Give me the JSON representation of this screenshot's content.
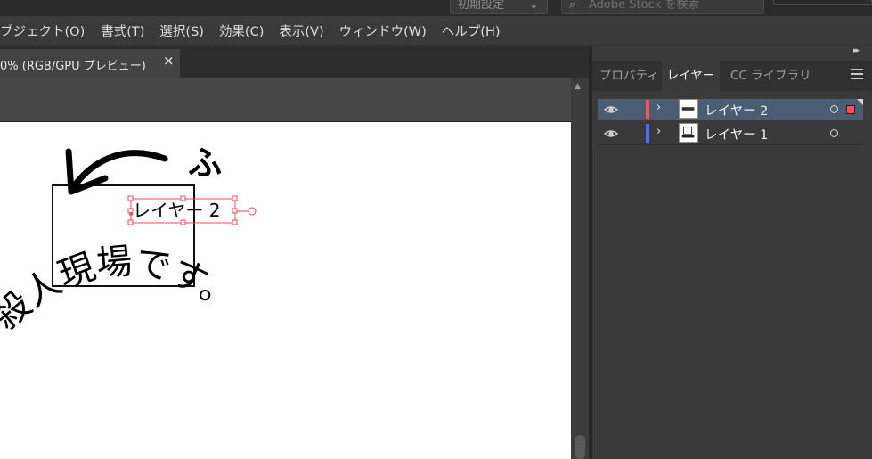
{
  "topbar": {
    "workspace": "初期設定",
    "stock_placeholder": "Adobe Stock を検索"
  },
  "menu": [
    "ブジェクト(O)",
    "書式(T)",
    "選択(S)",
    "効果(C)",
    "表示(V)",
    "ウィンドウ(W)",
    "ヘルプ(H)"
  ],
  "document_tab": {
    "label": "0% (RGB/GPU プレビュー)",
    "close": "×"
  },
  "canvas": {
    "selected_text": "レイヤー 2",
    "handwriting_top": "ふ",
    "handwriting_bottom": "殺人現場です。"
  },
  "panel": {
    "tabs": [
      "プロパティ",
      "レイヤー",
      "CC ライブラリ"
    ],
    "active_tab": "レイヤー",
    "layers": [
      {
        "name": "レイヤー 2",
        "color": "#ff4f57",
        "selected": true
      },
      {
        "name": "レイヤー 1",
        "color": "#4f6bff",
        "selected": false
      }
    ]
  },
  "colors": {
    "selection": "#ef4b55",
    "selected_row": "#4a5d73"
  }
}
